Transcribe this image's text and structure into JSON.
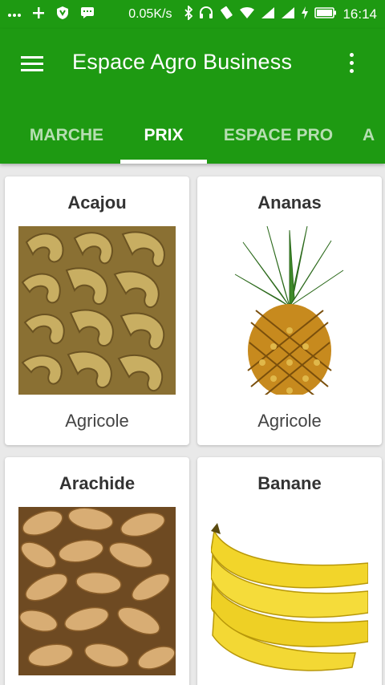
{
  "status_bar": {
    "left_icons": [
      "more-dots-icon",
      "plus-icon",
      "shield-icon",
      "chat-icon"
    ],
    "speed": "0.05K/s",
    "right_icons": [
      "bluetooth-icon",
      "headset-icon",
      "vibrate-icon",
      "wifi-icon",
      "signal-icon",
      "signal-icon",
      "charging-icon",
      "battery-icon"
    ],
    "time": "16:14"
  },
  "app_bar": {
    "title": "Espace Agro Business",
    "menu_icon": "hamburger-menu-icon",
    "overflow_icon": "overflow-menu-icon"
  },
  "tabs": [
    {
      "label": "MARCHE",
      "active": false
    },
    {
      "label": "PRIX",
      "active": true
    },
    {
      "label": "ESPACE PRO",
      "active": false
    },
    {
      "label": "A",
      "active": false
    }
  ],
  "products": [
    {
      "name": "Acajou",
      "category": "Agricole",
      "image": "cashew-nuts-photo"
    },
    {
      "name": "Ananas",
      "category": "Agricole",
      "image": "pineapple-photo"
    },
    {
      "name": "Arachide",
      "category": "",
      "image": "peanuts-photo"
    },
    {
      "name": "Banane",
      "category": "",
      "image": "bananas-photo"
    }
  ],
  "colors": {
    "primary": "#1e9a12",
    "card_bg": "#ffffff",
    "page_bg": "#e9e9e9"
  }
}
